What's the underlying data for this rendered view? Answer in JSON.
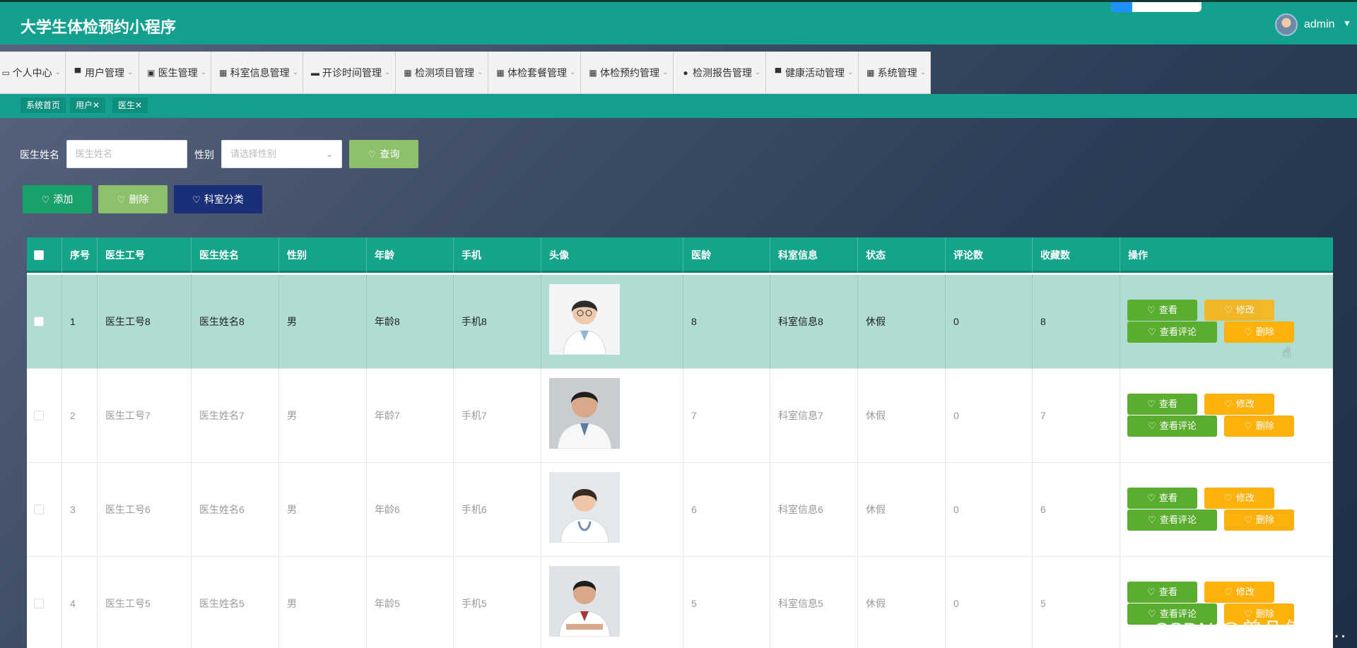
{
  "app": {
    "title": "大学生体检预约小程序"
  },
  "user": {
    "name": "admin"
  },
  "nav": [
    {
      "label": "个人中心",
      "icon": "square-icon"
    },
    {
      "label": "用户管理",
      "icon": "monitor-icon"
    },
    {
      "label": "医生管理",
      "icon": "clipboard-icon"
    },
    {
      "label": "科室信息管理",
      "icon": "grid-icon"
    },
    {
      "label": "开诊时间管理",
      "icon": "chat-icon"
    },
    {
      "label": "检测项目管理",
      "icon": "grid-icon"
    },
    {
      "label": "体检套餐管理",
      "icon": "grid-icon"
    },
    {
      "label": "体检预约管理",
      "icon": "grid-icon"
    },
    {
      "label": "检测报告管理",
      "icon": "user-icon"
    },
    {
      "label": "健康活动管理",
      "icon": "monitor-icon"
    },
    {
      "label": "系统管理",
      "icon": "grid-icon"
    }
  ],
  "tabs": [
    {
      "label": "系统首页"
    },
    {
      "label": "用户✕"
    },
    {
      "label": "医生✕"
    }
  ],
  "search": {
    "name_label": "医生姓名",
    "name_placeholder": "医生姓名",
    "gender_label": "性别",
    "gender_placeholder": "请选择性别",
    "query_button": "查询"
  },
  "actions": {
    "add": "添加",
    "delete": "删除",
    "category": "科室分类"
  },
  "table": {
    "headers": [
      "序号",
      "医生工号",
      "医生姓名",
      "性别",
      "年龄",
      "手机",
      "头像",
      "医龄",
      "科室信息",
      "状态",
      "评论数",
      "收藏数",
      "操作"
    ],
    "rows": [
      {
        "no": "1",
        "code": "医生工号8",
        "name": "医生姓名8",
        "gender": "男",
        "age": "年龄8",
        "phone": "手机8",
        "years": "8",
        "dept": "科室信息8",
        "status": "休假",
        "comments": "0",
        "favorites": "8"
      },
      {
        "no": "2",
        "code": "医生工号7",
        "name": "医生姓名7",
        "gender": "男",
        "age": "年龄7",
        "phone": "手机7",
        "years": "7",
        "dept": "科室信息7",
        "status": "休假",
        "comments": "0",
        "favorites": "7"
      },
      {
        "no": "3",
        "code": "医生工号6",
        "name": "医生姓名6",
        "gender": "男",
        "age": "年龄6",
        "phone": "手机6",
        "years": "6",
        "dept": "科室信息6",
        "status": "休假",
        "comments": "0",
        "favorites": "6"
      },
      {
        "no": "4",
        "code": "医生工号5",
        "name": "医生姓名5",
        "gender": "男",
        "age": "年龄5",
        "phone": "手机5",
        "years": "5",
        "dept": "科室信息5",
        "status": "休假",
        "comments": "0",
        "favorites": "5"
      }
    ],
    "ops": {
      "view": "查看",
      "edit": "修改",
      "view_comments": "查看评论",
      "delete": "删除"
    }
  },
  "watermark": "CSDN @曾几何时…",
  "colors": {
    "header": "#13a08f",
    "green_button": "#5aad2f",
    "orange_button": "#fdb10c",
    "navy_button": "#1a2f78",
    "highlight_row": "#b0ddd2"
  }
}
